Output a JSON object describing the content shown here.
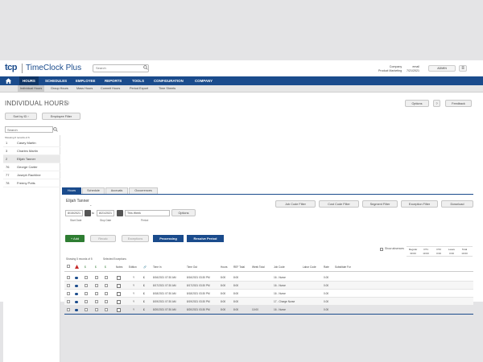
{
  "app": {
    "logo": "tcp",
    "product": "TimeClock Plus",
    "search_placeholder": "Search"
  },
  "header": {
    "company_label": "Company",
    "company_value": "Product Marketing",
    "user_label": "email",
    "user_date": "7/21/2021",
    "admin_label": "ADMIN"
  },
  "nav": {
    "items": [
      "HOURS",
      "SCHEDULES",
      "EMPLOYEE",
      "REPORTS",
      "TOOLS",
      "CONFIGURATION",
      "COMPANY"
    ],
    "active": "HOURS"
  },
  "subnav": {
    "items": [
      "Individual Hours",
      "Group Hours",
      "Mass Hours",
      "Commit Hours",
      "Period Export",
      "Time Sheets"
    ]
  },
  "page": {
    "title": "INDIVIDUAL HOURS",
    "help": "?",
    "options": "Options",
    "feedback": "Feedback",
    "sort_by": "Sort by ID ›",
    "employee_filter": "Employee Filter"
  },
  "left": {
    "search_placeholder": "Search",
    "showing": "Showing 6 records of 6",
    "employees": [
      {
        "id": "1",
        "name": "Casey Martin"
      },
      {
        "id": "3",
        "name": "Charles Martin"
      },
      {
        "id": "2",
        "name": "Elijah Tanner"
      },
      {
        "id": "76",
        "name": "George Carter"
      },
      {
        "id": "77",
        "name": "Joseph Rachline"
      },
      {
        "id": "78",
        "name": "Freeny Potts"
      }
    ],
    "selected_index": 2
  },
  "tabs": [
    "Hours",
    "Schedule",
    "Accruals",
    "Occurrences"
  ],
  "main": {
    "employee_name": "Elijah Tanner",
    "start_date": "8/15/2021",
    "to": "to",
    "end_date": "8/21/2021",
    "period": "This Week",
    "period_options": "Options",
    "start_label": "Start Date",
    "stop_label": "Stop Date",
    "period_label": "Period",
    "filters": [
      "Job Code Filter",
      "Cost Code Filter",
      "Segment Filter",
      "Exception Filter",
      "Download"
    ],
    "add": "+ Add",
    "recalculate": "Recalc",
    "exceptions": "Exceptions",
    "processing": "Processing",
    "resolve": "Resolve Period",
    "show_absences": "Show absences",
    "summary": [
      {
        "label": "Regular",
        "value": "30:00"
      },
      {
        "label": "OT1",
        "value": "10:00"
      },
      {
        "label": "OT2",
        "value": "0:00"
      },
      {
        "label": "Leave",
        "value": "0:00"
      },
      {
        "label": "Total",
        "value": "10:00"
      }
    ],
    "showing_rows": "Showing 5 records of 5",
    "selected_exceptions": "Selected Exceptions"
  },
  "grid": {
    "columns": [
      "Notes",
      "Edition",
      "Time In",
      "Time Out",
      "Hours",
      "REF Total",
      "Week Total",
      "Job Code",
      "Labor Code",
      "Rate",
      "Substitute For"
    ],
    "rows": [
      {
        "time_in": "8/16/2021 07:30 AM",
        "time_out": "8/16/2021 03:30 PM",
        "hours": "8:00",
        "ref": "8:00",
        "week": "",
        "job": "16 - Nurse",
        "labor": "",
        "rate": "0.00"
      },
      {
        "time_in": "8/17/2021 07:30 AM",
        "time_out": "8/17/2021 03:30 PM",
        "hours": "8:00",
        "ref": "8:00",
        "week": "",
        "job": "16 - Nurse",
        "labor": "",
        "rate": "0.00"
      },
      {
        "time_in": "8/18/2021 07:30 AM",
        "time_out": "8/18/2021 03:30 PM",
        "hours": "8:00",
        "ref": "8:00",
        "week": "",
        "job": "16 - Nurse",
        "labor": "",
        "rate": "0.00"
      },
      {
        "time_in": "8/19/2021 07:30 AM",
        "time_out": "8/19/2021 03:30 PM",
        "hours": "8:00",
        "ref": "8:00",
        "week": "",
        "job": "17 - Charge Nurse",
        "labor": "",
        "rate": "0.00"
      },
      {
        "time_in": "8/20/2021 07:30 AM",
        "time_out": "8/20/2021 03:30 PM",
        "hours": "8:00",
        "ref": "8:00",
        "week": "10:00",
        "job": "16 - Nurse",
        "labor": "",
        "rate": "0.00"
      }
    ]
  },
  "colors": {
    "brand": "#1a4b8c",
    "accent": "#e08a1e",
    "add": "#2e7d32"
  }
}
